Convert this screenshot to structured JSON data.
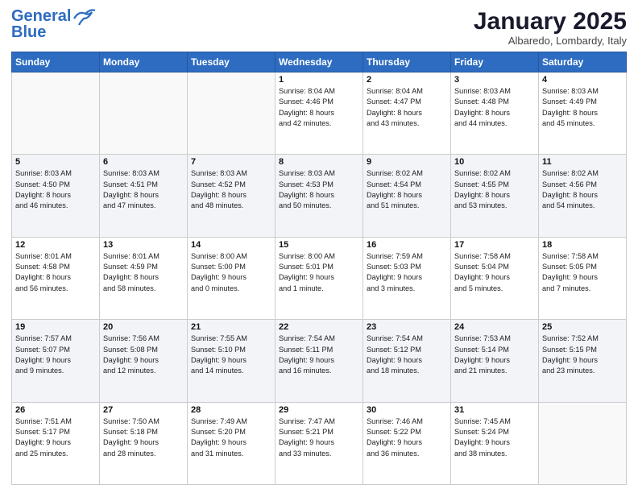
{
  "header": {
    "logo_line1": "General",
    "logo_line2": "Blue",
    "month": "January 2025",
    "location": "Albaredo, Lombardy, Italy"
  },
  "weekdays": [
    "Sunday",
    "Monday",
    "Tuesday",
    "Wednesday",
    "Thursday",
    "Friday",
    "Saturday"
  ],
  "weeks": [
    [
      {
        "day": "",
        "info": ""
      },
      {
        "day": "",
        "info": ""
      },
      {
        "day": "",
        "info": ""
      },
      {
        "day": "1",
        "info": "Sunrise: 8:04 AM\nSunset: 4:46 PM\nDaylight: 8 hours\nand 42 minutes."
      },
      {
        "day": "2",
        "info": "Sunrise: 8:04 AM\nSunset: 4:47 PM\nDaylight: 8 hours\nand 43 minutes."
      },
      {
        "day": "3",
        "info": "Sunrise: 8:03 AM\nSunset: 4:48 PM\nDaylight: 8 hours\nand 44 minutes."
      },
      {
        "day": "4",
        "info": "Sunrise: 8:03 AM\nSunset: 4:49 PM\nDaylight: 8 hours\nand 45 minutes."
      }
    ],
    [
      {
        "day": "5",
        "info": "Sunrise: 8:03 AM\nSunset: 4:50 PM\nDaylight: 8 hours\nand 46 minutes."
      },
      {
        "day": "6",
        "info": "Sunrise: 8:03 AM\nSunset: 4:51 PM\nDaylight: 8 hours\nand 47 minutes."
      },
      {
        "day": "7",
        "info": "Sunrise: 8:03 AM\nSunset: 4:52 PM\nDaylight: 8 hours\nand 48 minutes."
      },
      {
        "day": "8",
        "info": "Sunrise: 8:03 AM\nSunset: 4:53 PM\nDaylight: 8 hours\nand 50 minutes."
      },
      {
        "day": "9",
        "info": "Sunrise: 8:02 AM\nSunset: 4:54 PM\nDaylight: 8 hours\nand 51 minutes."
      },
      {
        "day": "10",
        "info": "Sunrise: 8:02 AM\nSunset: 4:55 PM\nDaylight: 8 hours\nand 53 minutes."
      },
      {
        "day": "11",
        "info": "Sunrise: 8:02 AM\nSunset: 4:56 PM\nDaylight: 8 hours\nand 54 minutes."
      }
    ],
    [
      {
        "day": "12",
        "info": "Sunrise: 8:01 AM\nSunset: 4:58 PM\nDaylight: 8 hours\nand 56 minutes."
      },
      {
        "day": "13",
        "info": "Sunrise: 8:01 AM\nSunset: 4:59 PM\nDaylight: 8 hours\nand 58 minutes."
      },
      {
        "day": "14",
        "info": "Sunrise: 8:00 AM\nSunset: 5:00 PM\nDaylight: 9 hours\nand 0 minutes."
      },
      {
        "day": "15",
        "info": "Sunrise: 8:00 AM\nSunset: 5:01 PM\nDaylight: 9 hours\nand 1 minute."
      },
      {
        "day": "16",
        "info": "Sunrise: 7:59 AM\nSunset: 5:03 PM\nDaylight: 9 hours\nand 3 minutes."
      },
      {
        "day": "17",
        "info": "Sunrise: 7:58 AM\nSunset: 5:04 PM\nDaylight: 9 hours\nand 5 minutes."
      },
      {
        "day": "18",
        "info": "Sunrise: 7:58 AM\nSunset: 5:05 PM\nDaylight: 9 hours\nand 7 minutes."
      }
    ],
    [
      {
        "day": "19",
        "info": "Sunrise: 7:57 AM\nSunset: 5:07 PM\nDaylight: 9 hours\nand 9 minutes."
      },
      {
        "day": "20",
        "info": "Sunrise: 7:56 AM\nSunset: 5:08 PM\nDaylight: 9 hours\nand 12 minutes."
      },
      {
        "day": "21",
        "info": "Sunrise: 7:55 AM\nSunset: 5:10 PM\nDaylight: 9 hours\nand 14 minutes."
      },
      {
        "day": "22",
        "info": "Sunrise: 7:54 AM\nSunset: 5:11 PM\nDaylight: 9 hours\nand 16 minutes."
      },
      {
        "day": "23",
        "info": "Sunrise: 7:54 AM\nSunset: 5:12 PM\nDaylight: 9 hours\nand 18 minutes."
      },
      {
        "day": "24",
        "info": "Sunrise: 7:53 AM\nSunset: 5:14 PM\nDaylight: 9 hours\nand 21 minutes."
      },
      {
        "day": "25",
        "info": "Sunrise: 7:52 AM\nSunset: 5:15 PM\nDaylight: 9 hours\nand 23 minutes."
      }
    ],
    [
      {
        "day": "26",
        "info": "Sunrise: 7:51 AM\nSunset: 5:17 PM\nDaylight: 9 hours\nand 25 minutes."
      },
      {
        "day": "27",
        "info": "Sunrise: 7:50 AM\nSunset: 5:18 PM\nDaylight: 9 hours\nand 28 minutes."
      },
      {
        "day": "28",
        "info": "Sunrise: 7:49 AM\nSunset: 5:20 PM\nDaylight: 9 hours\nand 31 minutes."
      },
      {
        "day": "29",
        "info": "Sunrise: 7:47 AM\nSunset: 5:21 PM\nDaylight: 9 hours\nand 33 minutes."
      },
      {
        "day": "30",
        "info": "Sunrise: 7:46 AM\nSunset: 5:22 PM\nDaylight: 9 hours\nand 36 minutes."
      },
      {
        "day": "31",
        "info": "Sunrise: 7:45 AM\nSunset: 5:24 PM\nDaylight: 9 hours\nand 38 minutes."
      },
      {
        "day": "",
        "info": ""
      }
    ]
  ]
}
